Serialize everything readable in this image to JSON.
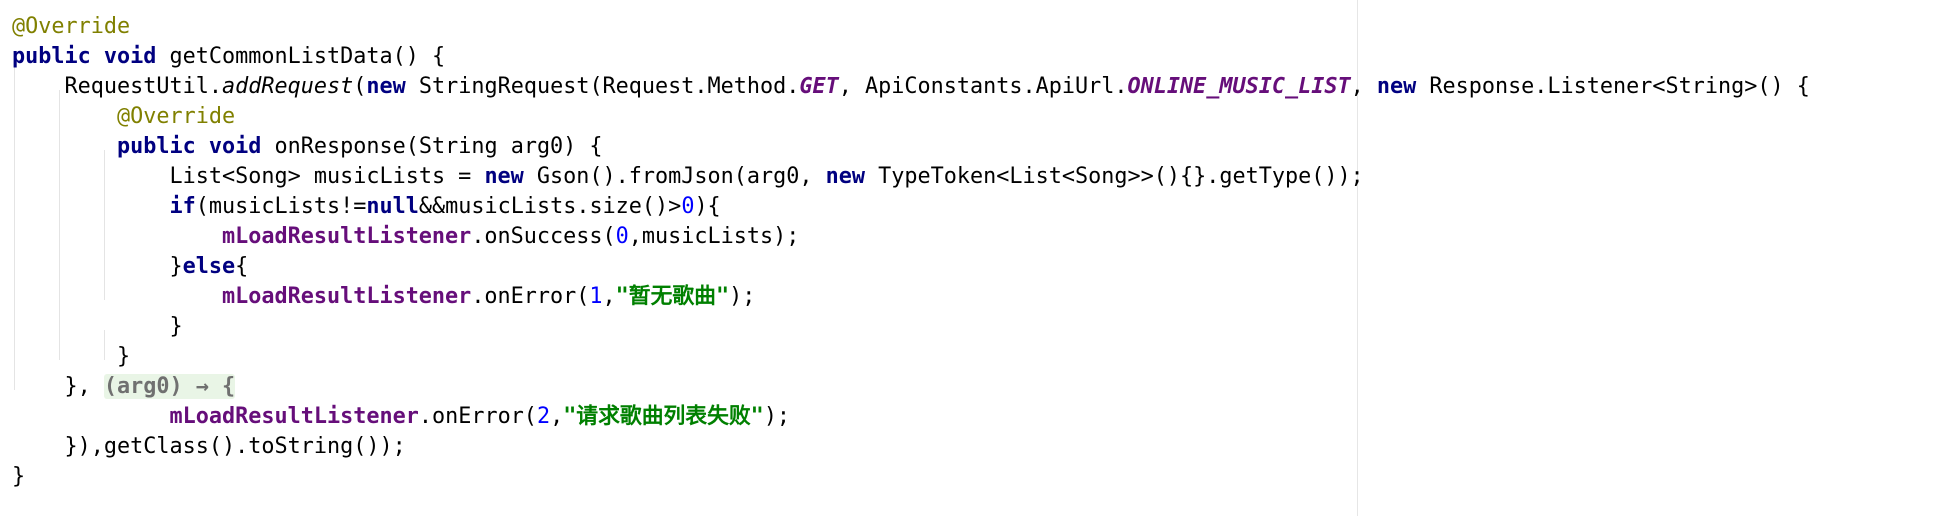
{
  "editor": {
    "lines": [
      {
        "indent": "",
        "tokens": [
          {
            "t": "@Override",
            "k": "annotation"
          }
        ]
      },
      {
        "indent": "",
        "tokens": [
          {
            "t": "public",
            "k": "kw"
          },
          {
            "t": " "
          },
          {
            "t": "void",
            "k": "kw"
          },
          {
            "t": " getCommonListData() {"
          }
        ]
      },
      {
        "indent": "    ",
        "tokens": [
          {
            "t": "RequestUtil."
          },
          {
            "t": "addRequest",
            "k": "static-call"
          },
          {
            "t": "("
          },
          {
            "t": "new",
            "k": "kw"
          },
          {
            "t": " StringRequest(Request.Method."
          },
          {
            "t": "GET",
            "k": "static-const"
          },
          {
            "t": ", ApiConstants.ApiUrl."
          },
          {
            "t": "ONLINE_MUSIC_LIST",
            "k": "static-const"
          },
          {
            "t": ", "
          },
          {
            "t": "new",
            "k": "kw"
          },
          {
            "t": " Response.Listener<String>() {"
          }
        ]
      },
      {
        "indent": "        ",
        "tokens": [
          {
            "t": "@Override",
            "k": "annotation"
          }
        ]
      },
      {
        "indent": "        ",
        "tokens": [
          {
            "t": "public",
            "k": "kw"
          },
          {
            "t": " "
          },
          {
            "t": "void",
            "k": "kw"
          },
          {
            "t": " onResponse(String arg0) {"
          }
        ]
      },
      {
        "indent": "            ",
        "tokens": [
          {
            "t": "List<Song> musicLists = "
          },
          {
            "t": "new",
            "k": "kw"
          },
          {
            "t": " Gson().fromJson(arg0, "
          },
          {
            "t": "new",
            "k": "kw"
          },
          {
            "t": " TypeToken<List<Song>>(){}.getType());"
          }
        ]
      },
      {
        "indent": "            ",
        "tokens": [
          {
            "t": "if",
            "k": "kw"
          },
          {
            "t": "(musicLists!="
          },
          {
            "t": "null",
            "k": "kw"
          },
          {
            "t": "&&musicLists.size()>"
          },
          {
            "t": "0",
            "k": "num"
          },
          {
            "t": "){"
          }
        ]
      },
      {
        "indent": "                ",
        "tokens": [
          {
            "t": "mLoadResultListener",
            "k": "field"
          },
          {
            "t": ".onSuccess("
          },
          {
            "t": "0",
            "k": "num"
          },
          {
            "t": ",musicLists);"
          }
        ]
      },
      {
        "indent": "            ",
        "tokens": [
          {
            "t": "}"
          },
          {
            "t": "else",
            "k": "kw"
          },
          {
            "t": "{"
          }
        ]
      },
      {
        "indent": "                ",
        "tokens": [
          {
            "t": "mLoadResultListener",
            "k": "field"
          },
          {
            "t": ".onError("
          },
          {
            "t": "1",
            "k": "num"
          },
          {
            "t": ","
          },
          {
            "t": "\"暂无歌曲\"",
            "k": "str"
          },
          {
            "t": ");"
          }
        ]
      },
      {
        "indent": "            ",
        "tokens": [
          {
            "t": "}"
          }
        ]
      },
      {
        "indent": "        ",
        "tokens": [
          {
            "t": "}"
          }
        ]
      },
      {
        "indent": "    ",
        "tokens": [
          {
            "t": "}, "
          },
          {
            "t": "(arg0) → {",
            "k": "lambda-fold"
          }
        ]
      },
      {
        "indent": "            ",
        "tokens": [
          {
            "t": "mLoadResultListener",
            "k": "field"
          },
          {
            "t": ".onError("
          },
          {
            "t": "2",
            "k": "num"
          },
          {
            "t": ","
          },
          {
            "t": "\"请求歌曲列表失败\"",
            "k": "str"
          },
          {
            "t": ");"
          }
        ]
      },
      {
        "indent": "    ",
        "tokens": [
          {
            "t": "}),getClass().toString());"
          }
        ]
      },
      {
        "indent": "",
        "tokens": [
          {
            "t": "}"
          }
        ]
      }
    ]
  }
}
